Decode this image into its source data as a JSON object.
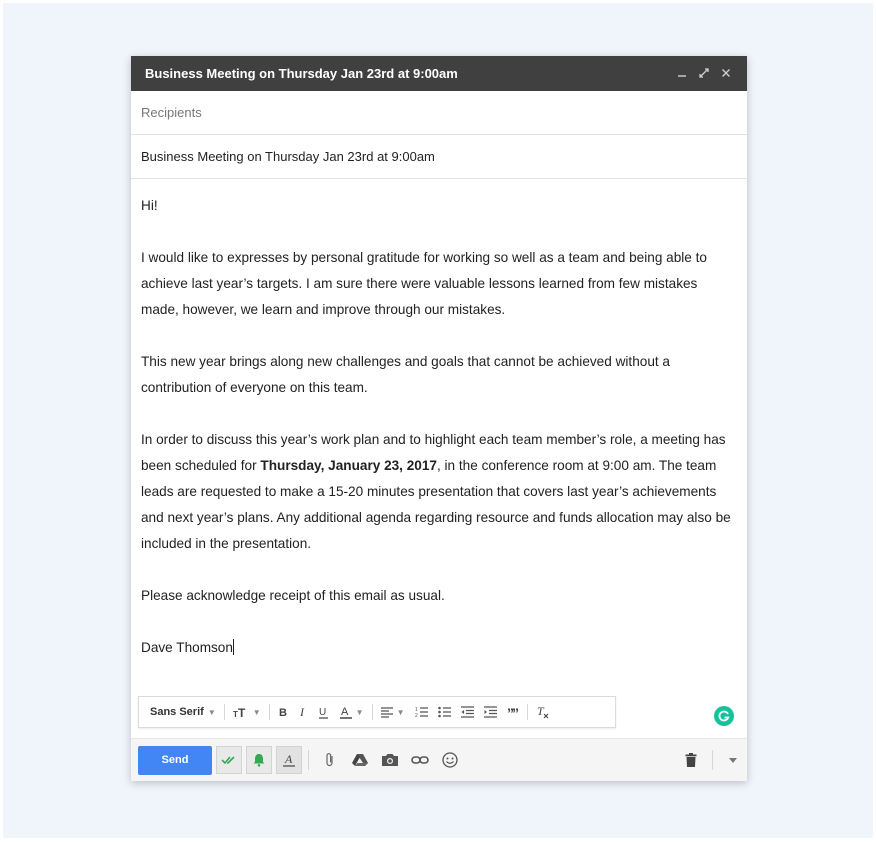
{
  "window": {
    "title": "Business Meeting on Thursday Jan 23rd at 9:00am",
    "controls": [
      "minimize",
      "expand",
      "close"
    ]
  },
  "fields": {
    "recipients_placeholder": "Recipients",
    "subject": "Business Meeting on Thursday Jan 23rd at 9:00am"
  },
  "body": {
    "greeting": "Hi!",
    "p1": "I would like to expresses by personal gratitude for working so well as a team and being able to achieve last year’s targets. I am sure there were valuable lessons learned from few mistakes made, however, we learn and improve through our mistakes.",
    "p2": "This new year brings along new challenges and goals that cannot be achieved without a contribution of everyone on this team.",
    "p3_before": "In order to discuss this year’s work plan and to highlight each team member’s role, a meeting has been scheduled for ",
    "p3_bold": "Thursday, January 23, 2017",
    "p3_after": ", in the conference room at 9:00 am. The team leads are requested to make a 15-20 minutes presentation that covers last year’s achievements and next year’s plans. Any additional agenda regarding resource and funds allocation may also be included in the presentation.",
    "p4": "Please acknowledge receipt of this email as usual.",
    "signature": "Dave Thomson"
  },
  "format_bar": {
    "font": "Sans Serif",
    "icons": [
      "font-size-icon",
      "bold-icon",
      "italic-icon",
      "underline-icon",
      "text-color-icon",
      "align-icon",
      "numbered-list-icon",
      "bulleted-list-icon",
      "indent-less-icon",
      "indent-more-icon",
      "quote-icon",
      "remove-formatting-icon"
    ]
  },
  "toolbar": {
    "send_label": "Send"
  },
  "colors": {
    "title_bar": "#404040",
    "send_button": "#4285f4",
    "accent_green": "#34a853",
    "grammarly": "#15c39a"
  }
}
